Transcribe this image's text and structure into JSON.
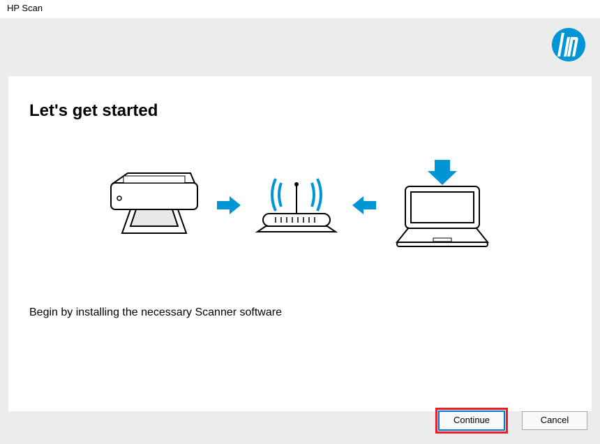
{
  "window": {
    "title": "HP Scan"
  },
  "brand": {
    "name": "hp",
    "color": "#0096d6"
  },
  "content": {
    "heading": "Let's get started",
    "instruction": "Begin by installing the necessary Scanner software"
  },
  "buttons": {
    "continue": "Continue",
    "cancel": "Cancel"
  },
  "accent": {
    "arrow_color": "#0096d6",
    "highlight_color": "#ec1c24"
  }
}
